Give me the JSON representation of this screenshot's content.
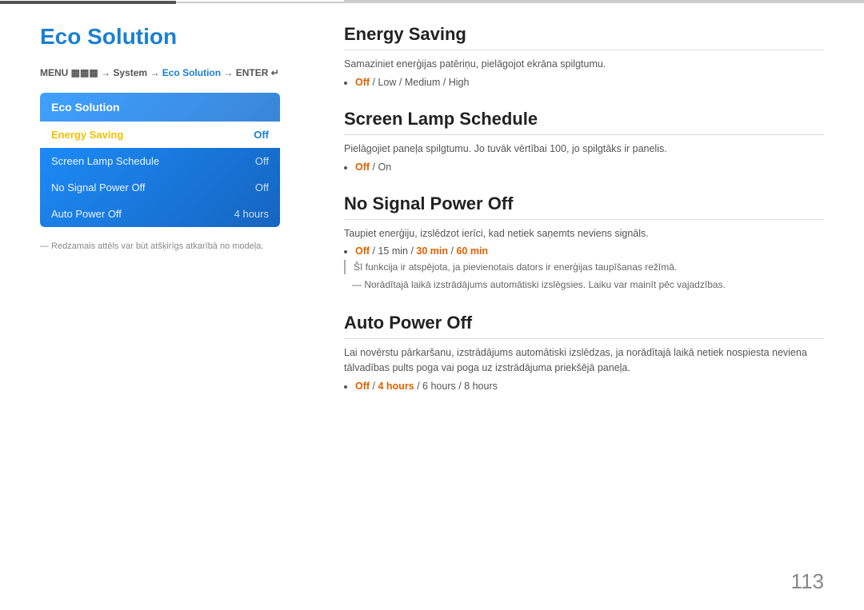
{
  "page": {
    "number": "113"
  },
  "top_lines": {
    "dark_line": true,
    "light_line": true
  },
  "left": {
    "title": "Eco Solution",
    "breadcrumb": {
      "full": "MENU  → System → Eco Solution → ENTER ",
      "menu_label": "MENU",
      "system_label": "System",
      "eco_label": "Eco Solution",
      "enter_label": "ENTER"
    },
    "menu_box": {
      "title": "Eco Solution",
      "items": [
        {
          "label": "Energy Saving",
          "value": "Off",
          "active": true
        },
        {
          "label": "Screen Lamp Schedule",
          "value": "Off",
          "active": false
        },
        {
          "label": "No Signal Power Off",
          "value": "Off",
          "active": false
        },
        {
          "label": "Auto Power Off",
          "value": "4 hours",
          "active": false
        }
      ]
    },
    "footnote": "― Redzamais attēls var būt atšķirīgs atkarībā no modeļa."
  },
  "right": {
    "sections": [
      {
        "id": "energy-saving",
        "title": "Energy Saving",
        "desc": "Samaziniet enerģijas patēriņu, pielāgojot ekrāna spilgtumu.",
        "options_text": "Off / Low / Medium / High",
        "options": [
          {
            "text": "Off",
            "highlight": true
          },
          {
            "text": " / ",
            "highlight": false
          },
          {
            "text": "Low",
            "highlight": false
          },
          {
            "text": " / ",
            "highlight": false
          },
          {
            "text": "Medium",
            "highlight": false
          },
          {
            "text": " / ",
            "highlight": false
          },
          {
            "text": "High",
            "highlight": false
          }
        ],
        "notes": []
      },
      {
        "id": "screen-lamp-schedule",
        "title": "Screen Lamp Schedule",
        "desc": "Pielāgojiet paneļa spilgtumu. Jo tuvāk vērtībai 100, jo spilgtāks ir panelis.",
        "options_text": "Off / On",
        "options": [
          {
            "text": "Off",
            "highlight": true
          },
          {
            "text": " / ",
            "highlight": false
          },
          {
            "text": "On",
            "highlight": false
          }
        ],
        "notes": []
      },
      {
        "id": "no-signal-power-off",
        "title": "No Signal Power Off",
        "desc": "Taupiet enerģiju, izslēdzot ierīci, kad netiek saņemts neviens signāls.",
        "options_text": "Off / 15 min / 30 min / 60 min",
        "options": [
          {
            "text": "Off",
            "highlight": true
          },
          {
            "text": " / ",
            "highlight": false
          },
          {
            "text": "15 min",
            "highlight": false
          },
          {
            "text": " / ",
            "highlight": false
          },
          {
            "text": "30 min",
            "highlight": false
          },
          {
            "text": " / ",
            "highlight": false
          },
          {
            "text": "60 min",
            "highlight": true
          }
        ],
        "notes": [
          "Šī funkcija ir atspējota, ja pievienotais dators ir enerģijas taupīšanas režīmā.",
          "Norādītajā laikā izstrādājums automātiski izslēgsies. Laiku var mainīt pēc vajadzības."
        ]
      },
      {
        "id": "auto-power-off",
        "title": "Auto Power Off",
        "desc": "Lai novērstu pārkaršanu, izstrādājums automātiski izslēdzas, ja norādītajā laikā netiek nospiesta neviena tālvadības pults poga vai poga uz izstrādājuma priekšējā paneļa.",
        "options_text": "Off / 4 hours / 6 hours / 8 hours",
        "options": [
          {
            "text": "Off",
            "highlight": true
          },
          {
            "text": " / ",
            "highlight": false
          },
          {
            "text": "4 hours",
            "highlight": false
          },
          {
            "text": " / ",
            "highlight": false
          },
          {
            "text": "6 hours",
            "highlight": false
          },
          {
            "text": " / ",
            "highlight": false
          },
          {
            "text": "8 hours",
            "highlight": false
          }
        ],
        "notes": []
      }
    ]
  }
}
